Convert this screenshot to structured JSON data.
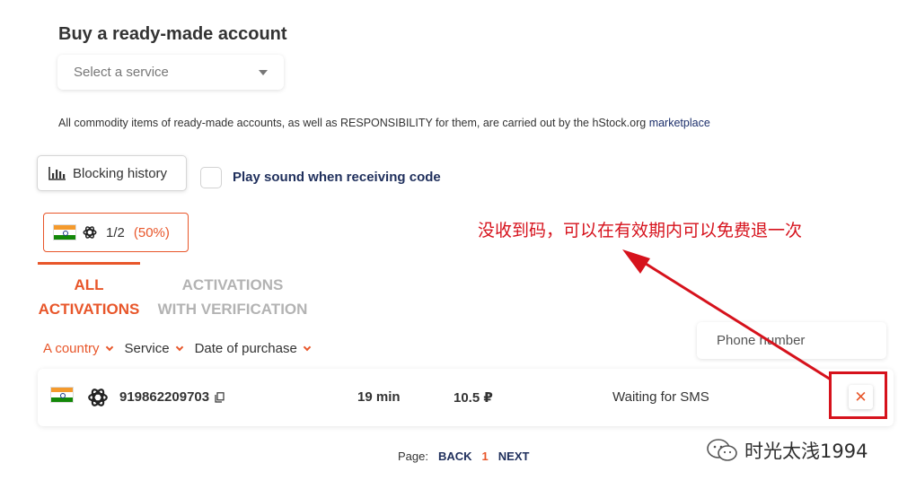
{
  "header": {
    "title": "Buy a ready-made account",
    "service_placeholder": "Select a service"
  },
  "notice": {
    "text": "All commodity items of ready-made accounts, as well as RESPONSIBILITY for them, are carried out by the hStock.org ",
    "link": "marketplace"
  },
  "toolbar": {
    "blocking_history": "Blocking history",
    "play_sound": "Play sound when receiving code"
  },
  "counter": {
    "count": "1/2",
    "percent": "(50%)"
  },
  "tabs": {
    "all": [
      "ALL",
      "ACTIVATIONS"
    ],
    "verification": [
      "ACTIVATIONS",
      "WITH VERIFICATION"
    ]
  },
  "filters": {
    "country": "A country",
    "service": "Service",
    "date": "Date of purchase",
    "phone_placeholder": "Phone number"
  },
  "activation": {
    "phone": "919862209703",
    "time": "19 min",
    "price": "10.5 ₽",
    "status": "Waiting for SMS",
    "cancel_icon": "✕"
  },
  "annotation": "没收到码，可以在有效期内可以免费退一次",
  "pagination": {
    "label": "Page:",
    "back": "BACK",
    "current": "1",
    "next": "NEXT"
  },
  "watermark": "时光太浅1994",
  "colors": {
    "accent": "#e8562a",
    "navy": "#1f2f5c",
    "annotation_red": "#d6121c"
  }
}
